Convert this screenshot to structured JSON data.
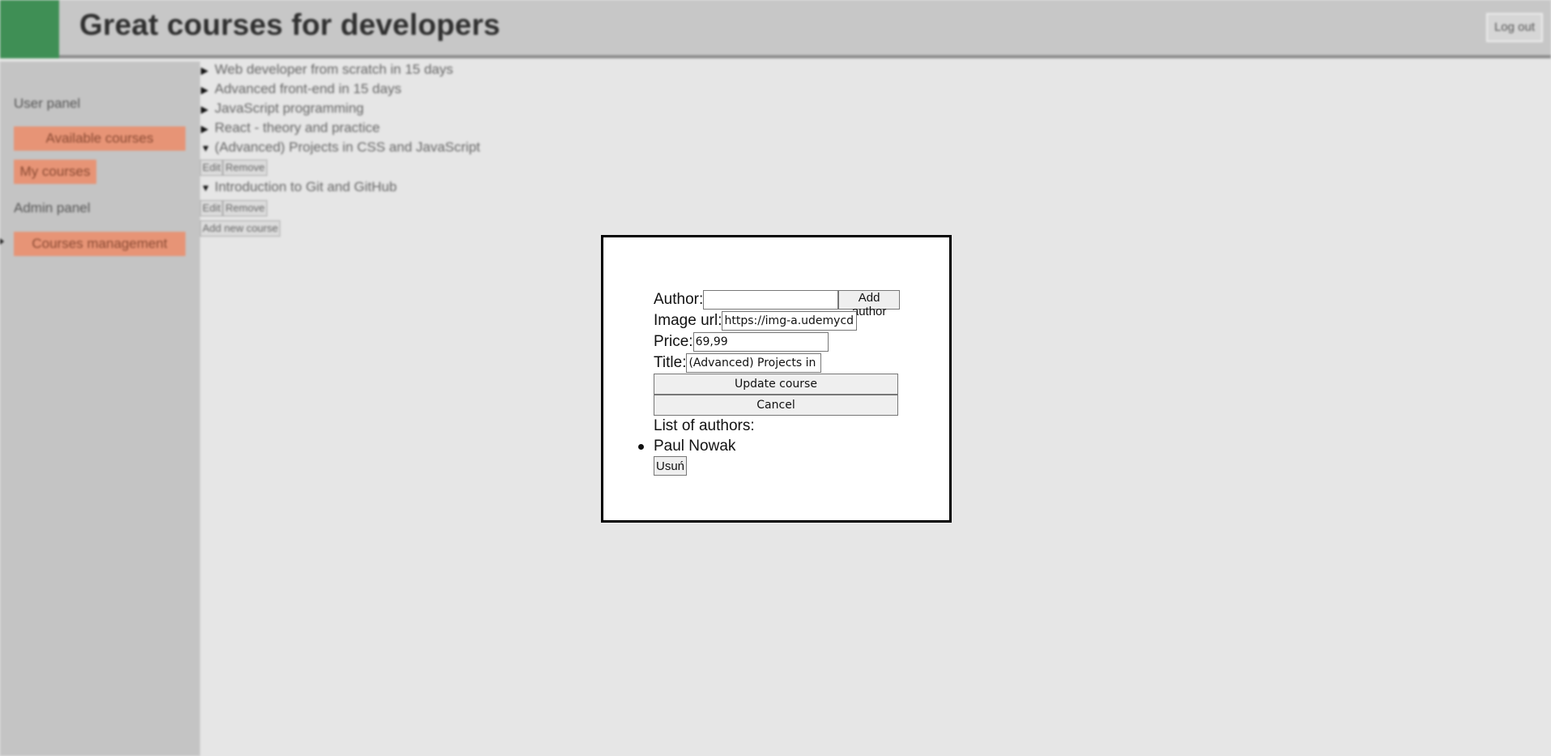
{
  "header": {
    "title": "Great courses for developers",
    "logout_label": "Log out"
  },
  "sidebar": {
    "user_panel_label": "User panel",
    "available_courses_label": "Available courses",
    "my_courses_label": "My courses",
    "admin_panel_label": "Admin panel",
    "courses_management_label": "Courses management"
  },
  "courses": [
    {
      "title": "Web developer from scratch in 15 days",
      "expanded": false
    },
    {
      "title": "Advanced front-end in 15 days",
      "expanded": false
    },
    {
      "title": "JavaScript programming",
      "expanded": false
    },
    {
      "title": "React - theory and practice",
      "expanded": false
    },
    {
      "title": "(Advanced) Projects in CSS and JavaScript",
      "expanded": true
    },
    {
      "title": "Introduction to Git and GitHub",
      "expanded": true
    }
  ],
  "course_actions": {
    "edit_label": "Edit",
    "remove_label": "Remove",
    "add_new_label": "Add new course"
  },
  "modal": {
    "author_label": "Author:",
    "author_value": "",
    "add_author_label": "Add author",
    "image_url_label": "Image url:",
    "image_url_value": "https://img-a.udemycdn.",
    "price_label": "Price:",
    "price_value": "69,99",
    "title_label": "Title:",
    "title_value": "(Advanced) Projects in C",
    "update_label": "Update course",
    "cancel_label": "Cancel",
    "authors_list_label": "List of authors:",
    "authors": [
      {
        "name": "Paul Nowak",
        "remove_label": "Usuń"
      }
    ]
  },
  "colors": {
    "logo_green": "#3f8f55",
    "sidebar_button": "#e79476",
    "header_bg": "#c7c7c7",
    "sidebar_bg": "#c4c4c4",
    "page_bg": "#e6e6e6"
  }
}
